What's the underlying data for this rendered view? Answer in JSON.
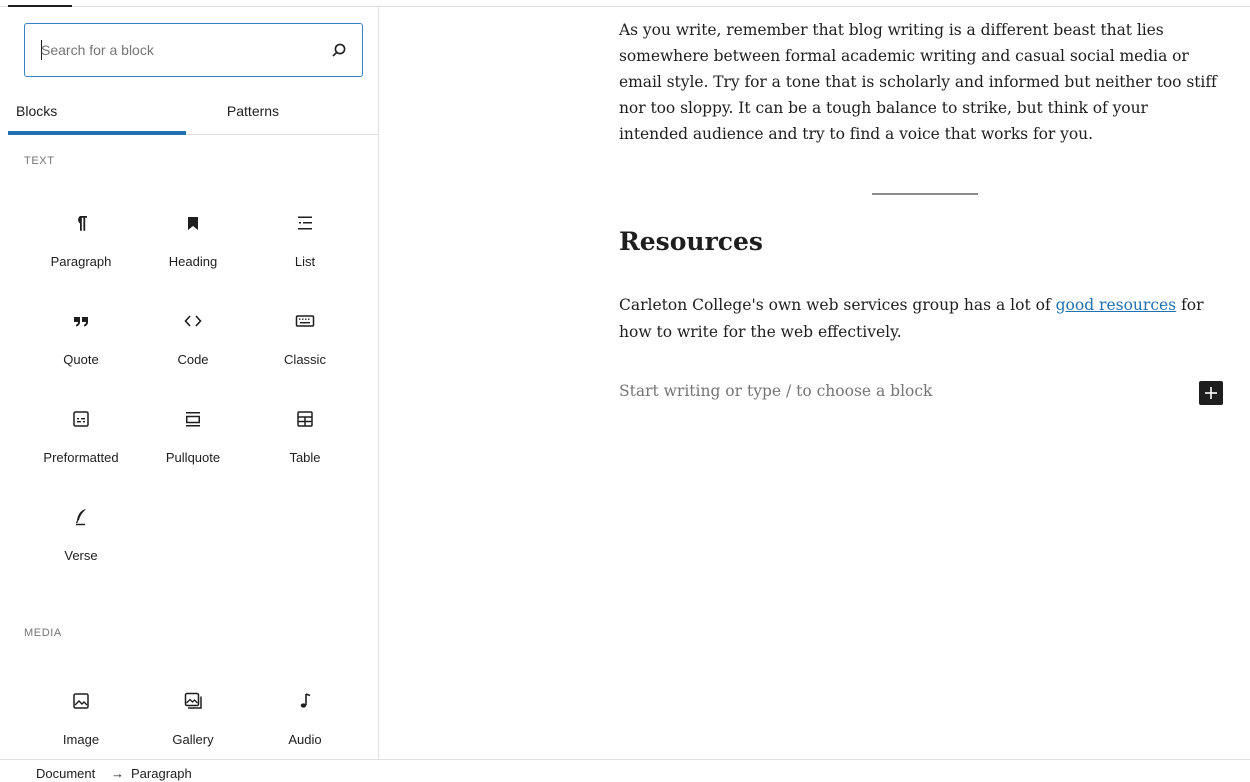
{
  "inserter": {
    "search_placeholder": "Search for a block",
    "tabs": [
      {
        "label": "Blocks",
        "selected": true
      },
      {
        "label": "Patterns",
        "selected": false
      }
    ],
    "categories": {
      "text": "TEXT",
      "media": "MEDIA"
    },
    "text_blocks": [
      {
        "label": "Paragraph",
        "icon": "paragraph-icon"
      },
      {
        "label": "Heading",
        "icon": "heading-icon"
      },
      {
        "label": "List",
        "icon": "list-icon"
      },
      {
        "label": "Quote",
        "icon": "quote-icon"
      },
      {
        "label": "Code",
        "icon": "code-icon"
      },
      {
        "label": "Classic",
        "icon": "keyboard-icon"
      },
      {
        "label": "Preformatted",
        "icon": "preformatted-icon"
      },
      {
        "label": "Pullquote",
        "icon": "pullquote-icon"
      },
      {
        "label": "Table",
        "icon": "table-icon"
      },
      {
        "label": "Verse",
        "icon": "feather-icon"
      }
    ],
    "media_blocks": [
      {
        "label": "Image",
        "icon": "image-icon"
      },
      {
        "label": "Gallery",
        "icon": "gallery-icon"
      },
      {
        "label": "Audio",
        "icon": "audio-icon"
      }
    ]
  },
  "editor": {
    "intro_paragraph": "As you write, remember that blog writing is a different beast that lies somewhere between formal academic writing and casual social media or email style.  Try for a tone that is scholarly and informed but neither too stiff nor too sloppy.  It can be a tough balance to strike, but think of your intended audience and try to find a voice that works for you.",
    "heading": "Resources",
    "resources_before": "Carleton College's own web services group has a lot of ",
    "resources_link": "good resources",
    "resources_after": " for how to write for the web effectively.",
    "placeholder": "Start writing or type / to choose a block"
  },
  "breadcrumb": {
    "document": "Document",
    "separator": "→",
    "current": "Paragraph"
  },
  "colors": {
    "accent": "#2271b1",
    "focus_border": "#3582c4",
    "text": "#1e1e1e",
    "muted": "#757575"
  }
}
